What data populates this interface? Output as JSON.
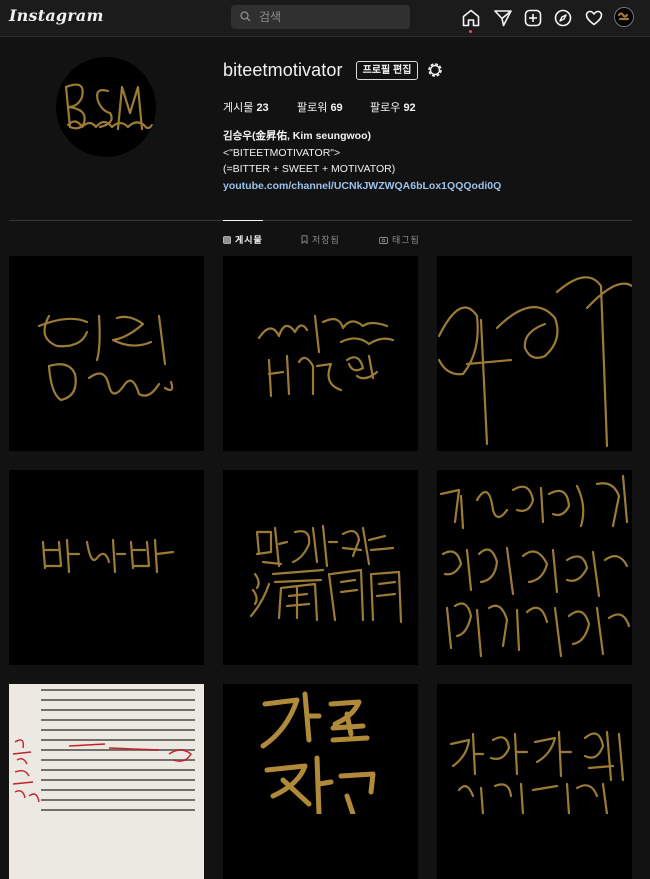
{
  "app": {
    "logo": "Instagram"
  },
  "search": {
    "placeholder": "검색"
  },
  "nav": {
    "icons": [
      "home-icon",
      "direct-message-icon",
      "new-post-icon",
      "explore-icon",
      "activity-heart-icon",
      "profile-avatar"
    ]
  },
  "profile": {
    "username": "biteetmotivator",
    "edit_label": "프로필 편집",
    "stats": {
      "posts_label": "게시물",
      "posts_count": "23",
      "followers_label": "팔로워",
      "followers_count": "69",
      "following_label": "팔로우",
      "following_count": "92"
    },
    "bio": {
      "name": "김승우(金昇佑, Kim seungwoo)",
      "line1": "<\"BITEETMOTIVATOR\">",
      "line2": "(=BITTER + SWEET + MOTIVATOR)",
      "link": "youtube.com/channel/UCNkJWZWQA6bLox1QQQodi0Q"
    }
  },
  "tabs": [
    {
      "label": "게시물",
      "icon": "grid-icon",
      "active": true
    },
    {
      "label": "저장됨",
      "icon": "bookmark-icon",
      "active": false
    },
    {
      "label": "태그됨",
      "icon": "tagged-icon",
      "active": false
    }
  ],
  "colors": {
    "background": "#121212",
    "calligraphy_gold": "#9c7b34",
    "link_blue": "#9bc2ea",
    "notification_red": "#ed4956"
  },
  "posts": [
    {
      "type": "calligraphy-image"
    },
    {
      "type": "calligraphy-image"
    },
    {
      "type": "calligraphy-image"
    },
    {
      "type": "calligraphy-image"
    },
    {
      "type": "calligraphy-image"
    },
    {
      "type": "calligraphy-image"
    },
    {
      "type": "handwritten-notes-photo"
    },
    {
      "type": "calligraphy-image"
    },
    {
      "type": "calligraphy-image"
    }
  ]
}
